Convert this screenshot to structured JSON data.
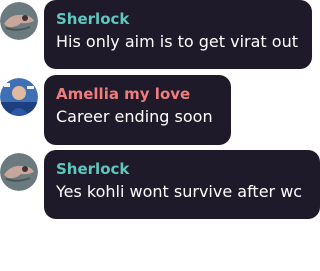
{
  "messages": [
    {
      "sender": "Sherlock",
      "text": "His only aim is to get virat out",
      "name_color": "#5ec7be",
      "avatar": "sherlock-avatar"
    },
    {
      "sender": "Amellia my love",
      "text": "Career ending soon",
      "name_color": "#f07c7c",
      "avatar": "amellia-avatar"
    },
    {
      "sender": "Sherlock",
      "text": "Yes kohli wont survive after wc",
      "name_color": "#5ec7be",
      "avatar": "sherlock-avatar"
    }
  ],
  "colors": {
    "bubble": "#1e1a29",
    "message_text": "#ffffff"
  }
}
